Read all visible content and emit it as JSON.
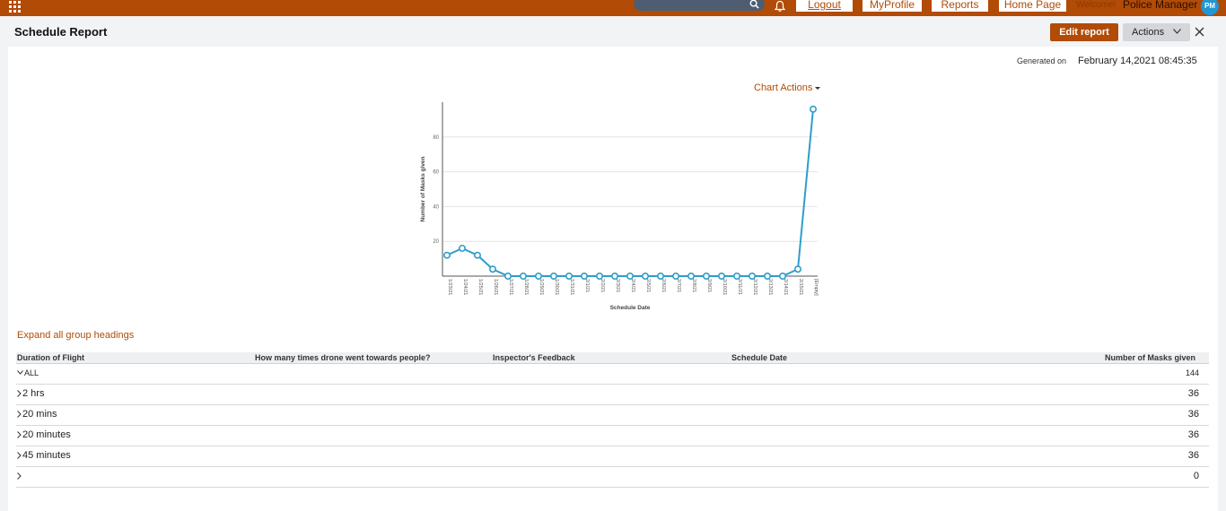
{
  "topbar": {
    "search_placeholder": "",
    "nav": [
      "Logout",
      "MyProfile",
      "Reports",
      "Home Page"
    ],
    "welcome": "Welcome!",
    "username": "Police Manager",
    "avatar_initials": "PM",
    "accent_color": "#b14b06"
  },
  "header": {
    "title": "Schedule Report",
    "edit_label": "Edit report",
    "actions_label": "Actions"
  },
  "report": {
    "generated_label": "Generated on",
    "generated_value": "February 14,2021 08:45:35",
    "chart_actions_label": "Chart Actions",
    "expand_label": "Expand all group headings"
  },
  "chart_data": {
    "type": "line",
    "xlabel": "Schedule Date",
    "ylabel": "Number of Masks given",
    "ylim": [
      0,
      100
    ],
    "yticks": [
      20,
      40,
      60,
      80
    ],
    "categories": [
      "1/23/21",
      "1/24/21",
      "1/25/21",
      "1/26/21",
      "1/27/21",
      "1/28/21",
      "1/29/21",
      "1/30/21",
      "1/31/21",
      "2/1/21",
      "2/2/21",
      "2/3/21",
      "2/4/21",
      "2/5/21",
      "2/6/21",
      "2/7/21",
      "2/8/21",
      "2/9/21",
      "2/10/21",
      "2/11/21",
      "2/12/21",
      "2/13/21",
      "2/14/21",
      "2/15/21",
      "[Empty]"
    ],
    "values": [
      12,
      16,
      12,
      4,
      0,
      0,
      0,
      0,
      0,
      0,
      0,
      0,
      0,
      0,
      0,
      0,
      0,
      0,
      0,
      0,
      0,
      0,
      0,
      4,
      96
    ],
    "grid": true,
    "line_color": "#2e9ec9"
  },
  "table": {
    "columns": [
      "Duration of Flight",
      "How many times drone went towards people?",
      "Inspector's Feedback",
      "Schedule Date",
      "Number of Masks given"
    ],
    "rows": [
      {
        "label": "ALL",
        "value": "144"
      },
      {
        "label": "2 hrs",
        "value": "36"
      },
      {
        "label": "20 mins",
        "value": "36"
      },
      {
        "label": "20 minutes",
        "value": "36"
      },
      {
        "label": "45 minutes",
        "value": "36"
      },
      {
        "label": "",
        "value": "0"
      }
    ]
  }
}
